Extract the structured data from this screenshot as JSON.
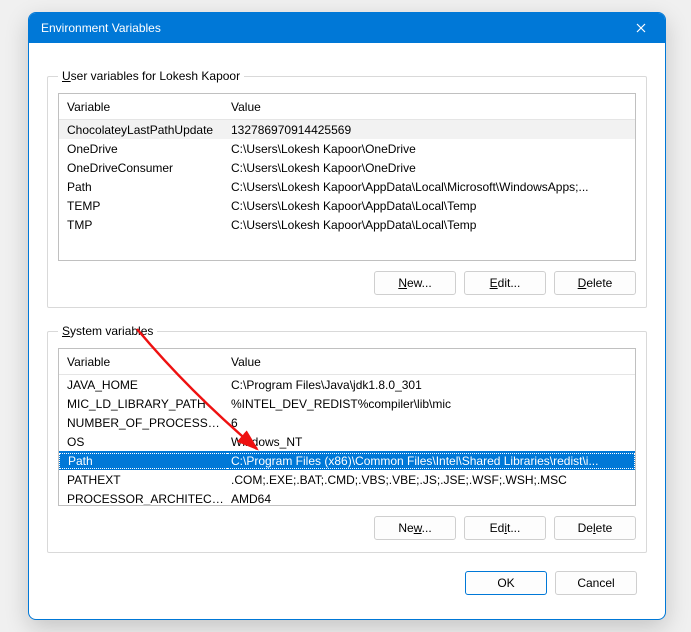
{
  "window": {
    "title": "Environment Variables"
  },
  "user_section": {
    "legend_prefix": "U",
    "legend_rest": "ser variables for Lokesh Kapoor",
    "header_variable": "Variable",
    "header_value": "Value",
    "rows": [
      {
        "variable": "ChocolateyLastPathUpdate",
        "value": "132786970914425569"
      },
      {
        "variable": "OneDrive",
        "value": "C:\\Users\\Lokesh Kapoor\\OneDrive"
      },
      {
        "variable": "OneDriveConsumer",
        "value": "C:\\Users\\Lokesh Kapoor\\OneDrive"
      },
      {
        "variable": "Path",
        "value": "C:\\Users\\Lokesh Kapoor\\AppData\\Local\\Microsoft\\WindowsApps;..."
      },
      {
        "variable": "TEMP",
        "value": "C:\\Users\\Lokesh Kapoor\\AppData\\Local\\Temp"
      },
      {
        "variable": "TMP",
        "value": "C:\\Users\\Lokesh Kapoor\\AppData\\Local\\Temp"
      }
    ],
    "buttons": {
      "new_u": "N",
      "new_rest": "ew...",
      "edit_u": "E",
      "edit_rest": "dit...",
      "delete_u": "D",
      "delete_rest": "elete"
    }
  },
  "system_section": {
    "legend_prefix": "S",
    "legend_rest": "ystem variables",
    "header_variable": "Variable",
    "header_value": "Value",
    "rows": [
      {
        "variable": "JAVA_HOME",
        "value": "C:\\Program Files\\Java\\jdk1.8.0_301"
      },
      {
        "variable": "MIC_LD_LIBRARY_PATH",
        "value": "%INTEL_DEV_REDIST%compiler\\lib\\mic"
      },
      {
        "variable": "NUMBER_OF_PROCESSORS",
        "value": "6"
      },
      {
        "variable": "OS",
        "value": "Windows_NT"
      },
      {
        "variable": "Path",
        "value": "C:\\Program Files (x86)\\Common Files\\Intel\\Shared Libraries\\redist\\i..."
      },
      {
        "variable": "PATHEXT",
        "value": ".COM;.EXE;.BAT;.CMD;.VBS;.VBE;.JS;.JSE;.WSF;.WSH;.MSC"
      },
      {
        "variable": "PROCESSOR_ARCHITECTURE",
        "value": "AMD64"
      }
    ],
    "selected_index": 4,
    "buttons": {
      "new_u": "w",
      "new_pre": "Ne",
      "new_rest": "...",
      "edit_u": "i",
      "edit_pre": "Ed",
      "edit_rest": "t...",
      "delete_u": "l",
      "delete_pre": "De",
      "delete_rest": "ete"
    }
  },
  "footer": {
    "ok": "OK",
    "cancel": "Cancel"
  }
}
